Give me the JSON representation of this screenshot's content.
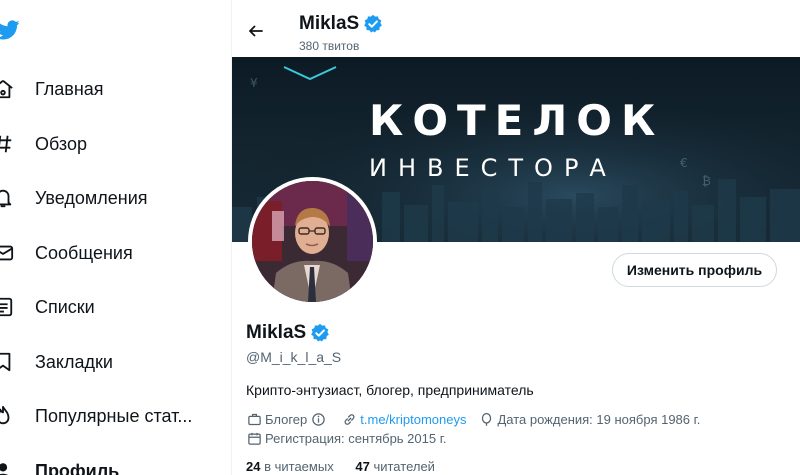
{
  "sidebar": {
    "items": [
      {
        "label": "Главная",
        "icon": "home-icon"
      },
      {
        "label": "Обзор",
        "icon": "hashtag-icon"
      },
      {
        "label": "Уведомления",
        "icon": "bell-icon"
      },
      {
        "label": "Сообщения",
        "icon": "envelope-icon"
      },
      {
        "label": "Списки",
        "icon": "list-icon"
      },
      {
        "label": "Закладки",
        "icon": "bookmark-icon"
      },
      {
        "label": "Популярные стат...",
        "icon": "fire-icon"
      },
      {
        "label": "Профиль",
        "icon": "person-icon"
      }
    ]
  },
  "header": {
    "name": "MiklaS",
    "tweet_count": "380 твитов"
  },
  "banner": {
    "title": "КОТЕЛОК",
    "subtitle": "ИНВЕСТОРА"
  },
  "profile": {
    "edit_button": "Изменить профиль",
    "name": "MiklaS",
    "handle": "@M_i_k_l_a_S",
    "bio": "Крипто-энтузиаст, блогер, предприниматель",
    "category": "Блогер",
    "link": "t.me/kriptomoneys",
    "birth": "Дата рождения: 19 ноября 1986 г.",
    "joined": "Регистрация: сентябрь 2015 г.",
    "following_count": "24",
    "following_label": "в читаемых",
    "followers_count": "47",
    "followers_label": "читателей"
  },
  "colors": {
    "accent": "#1d9bf0",
    "text": "#0f1419",
    "muted": "#536471"
  }
}
